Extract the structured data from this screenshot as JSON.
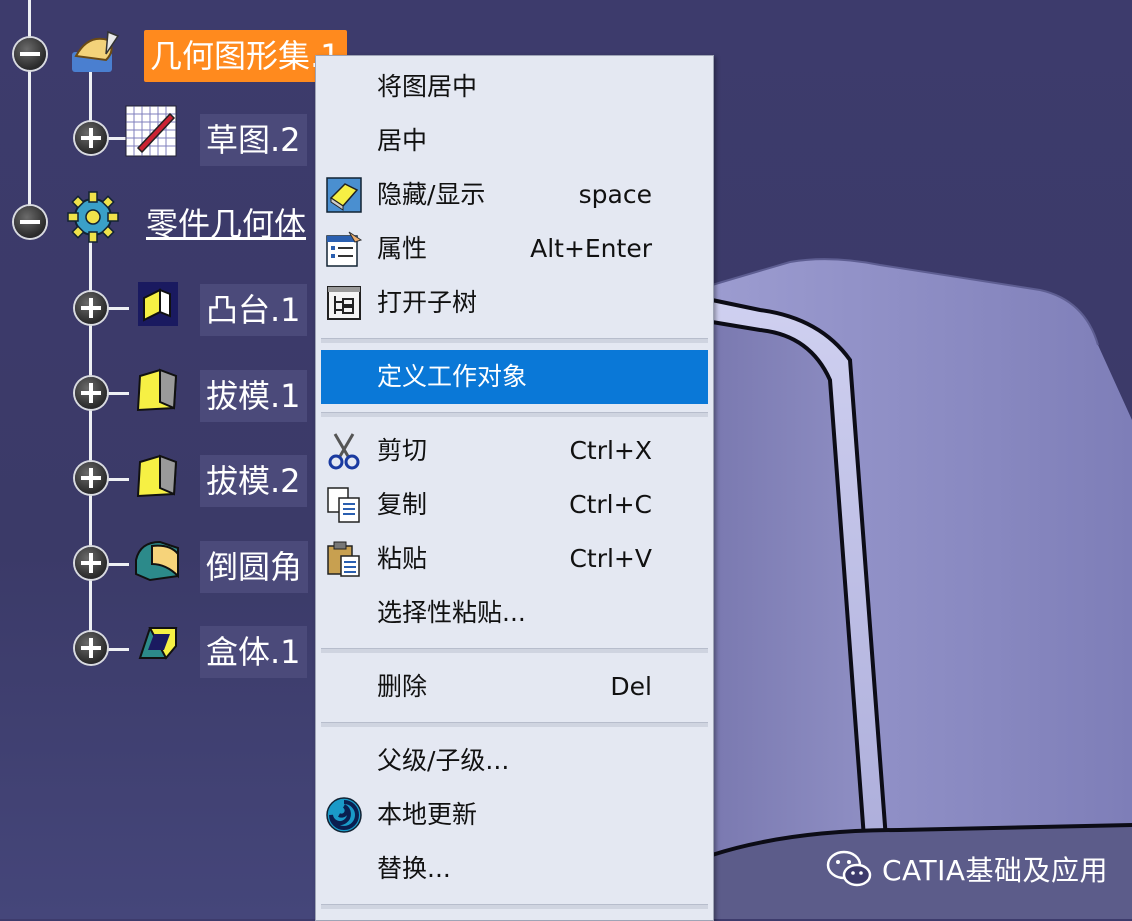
{
  "tree": {
    "items": [
      {
        "label": "几何图形集.1",
        "expander": "minus",
        "icon": "geometrical-set-icon"
      },
      {
        "label": "草图.2",
        "expander": "plus",
        "icon": "sketch-icon"
      },
      {
        "label": "零件几何体",
        "expander": "minus",
        "icon": "part-body-gear-icon"
      },
      {
        "label": "凸台.1",
        "expander": "plus",
        "icon": "pad-icon"
      },
      {
        "label": "拔模.1",
        "expander": "plus",
        "icon": "draft-icon"
      },
      {
        "label": "拔模.2",
        "expander": "plus",
        "icon": "draft-icon"
      },
      {
        "label": "倒圆角",
        "expander": "plus",
        "icon": "fillet-icon"
      },
      {
        "label": "盒体.1",
        "expander": "plus",
        "icon": "shell-icon"
      }
    ]
  },
  "context_menu": {
    "items": [
      {
        "label": "将图居中",
        "shortcut": "",
        "icon": ""
      },
      {
        "label": "居中",
        "shortcut": "",
        "icon": ""
      },
      {
        "label": "隐藏/显示",
        "shortcut": "space",
        "icon": "hide-show-icon"
      },
      {
        "label": "属性",
        "shortcut": "Alt+Enter",
        "icon": "properties-icon"
      },
      {
        "label": "打开子树",
        "shortcut": "",
        "icon": "open-subtree-icon"
      },
      {
        "label": "定义工作对象",
        "shortcut": "",
        "icon": "",
        "highlighted": true
      },
      {
        "label": "剪切",
        "shortcut": "Ctrl+X",
        "icon": "scissors-icon"
      },
      {
        "label": "复制",
        "shortcut": "Ctrl+C",
        "icon": "copy-icon"
      },
      {
        "label": "粘贴",
        "shortcut": "Ctrl+V",
        "icon": "paste-icon"
      },
      {
        "label": "选择性粘贴...",
        "shortcut": "",
        "icon": ""
      },
      {
        "label": "删除",
        "shortcut": "Del",
        "icon": ""
      },
      {
        "label": "父级/子级...",
        "shortcut": "",
        "icon": ""
      },
      {
        "label": "本地更新",
        "shortcut": "",
        "icon": "local-update-icon"
      },
      {
        "label": "替换...",
        "shortcut": "",
        "icon": ""
      }
    ]
  },
  "watermark": {
    "text": "CATIA基础及应用",
    "icon": "wechat-icon"
  },
  "colors": {
    "background": "#3d3b6c",
    "selection_orange": "#ff8a1e",
    "menu_highlight": "#0a78d7",
    "menu_bg": "#e4e8f2"
  }
}
